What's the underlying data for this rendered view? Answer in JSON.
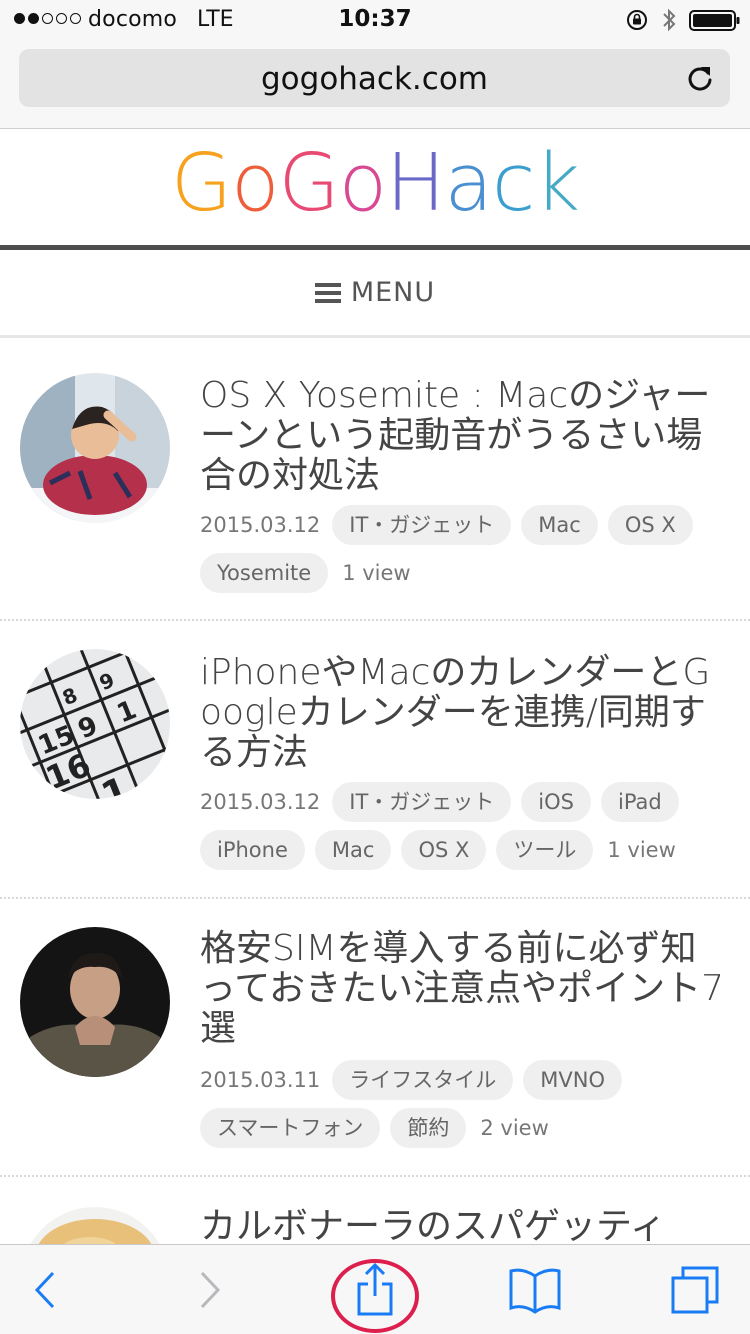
{
  "status": {
    "carrier": "docomo",
    "network": "LTE",
    "time": "10:37",
    "signal_bars_total": 5,
    "signal_bars_filled": 2,
    "icons": [
      "rotation-lock-icon",
      "bluetooth-icon",
      "battery-icon"
    ]
  },
  "browser": {
    "url": "gogohack.com",
    "reload_icon": "reload-icon"
  },
  "site": {
    "logo_letters": [
      "G",
      "o",
      "G",
      "o",
      "H",
      "a",
      "c",
      "k"
    ],
    "logo_colors": [
      "#f6a21e",
      "#ee5e3a",
      "#e84a73",
      "#d94993",
      "#6a69c9",
      "#4a8fd1",
      "#3a9fcf",
      "#46aac4"
    ],
    "menu_label": "MENU"
  },
  "articles": [
    {
      "title": "OS X Yosemite : Macのジャーーンという起動音がうるさい場合の対処法",
      "date": "2015.03.12",
      "tags": [
        "IT・ガジェット",
        "Mac",
        "OS X",
        "Yosemite"
      ],
      "views": "1 view",
      "thumbnail": "person-thinking-photo"
    },
    {
      "title": "iPhoneやMacのカレンダーとGoogleカレンダーを連携/同期する方法",
      "date": "2015.03.12",
      "tags": [
        "IT・ガジェット",
        "iOS",
        "iPad",
        "iPhone",
        "Mac",
        "OS X",
        "ツール"
      ],
      "views": "1 view",
      "thumbnail": "calendar-photo"
    },
    {
      "title": "格安SIMを導入する前に必ず知っておきたい注意点やポイント7選",
      "date": "2015.03.11",
      "tags": [
        "ライフスタイル",
        "MVNO",
        "スマートフォン",
        "節約"
      ],
      "views": "2 view",
      "thumbnail": "man-portrait-photo"
    },
    {
      "title": "カルボナーラのスパゲッティ",
      "thumbnail": "pasta-photo"
    }
  ],
  "toolbar": {
    "buttons": [
      "back-icon",
      "forward-icon",
      "share-icon",
      "bookmarks-icon",
      "tabs-icon"
    ],
    "accent": "#1a7cf5",
    "highlight": "#dc1f4c"
  }
}
